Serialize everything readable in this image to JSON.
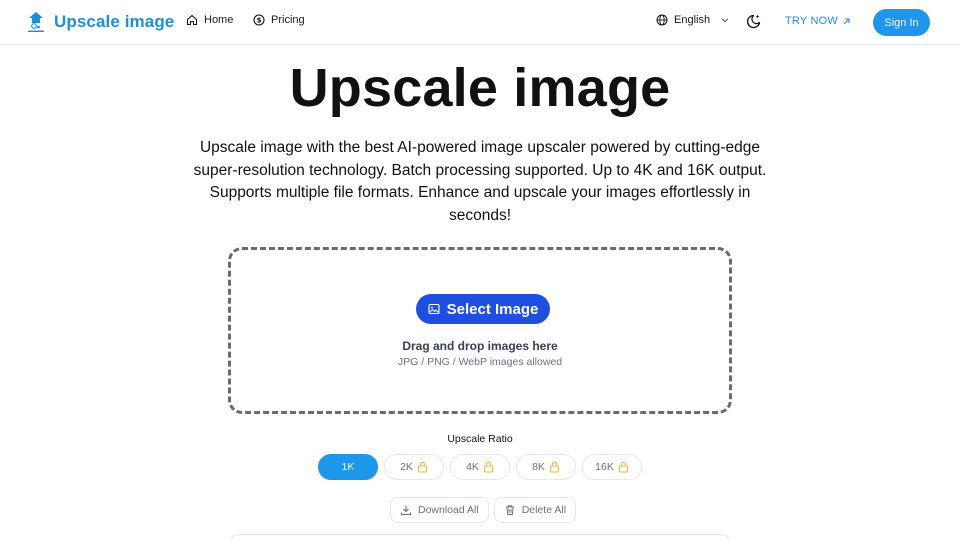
{
  "header": {
    "logo_text": "Upscale image",
    "logo_icon": "upscale-logo-icon",
    "nav": [
      {
        "label": "Home",
        "icon": "home-icon"
      },
      {
        "label": "Pricing",
        "icon": "dollar-circle-icon"
      }
    ],
    "language": "English",
    "theme_toggle_icon": "moon-sparkle-icon",
    "try_now": "TRY NOW",
    "sign_in": "Sign In"
  },
  "hero": {
    "title": "Upscale image",
    "description": "Upscale image with the best AI-powered image upscaler powered by cutting-edge super-resolution technology. Batch processing supported. Up to 4K and 16K output. Supports multiple file formats. Enhance and upscale your images effortlessly in seconds!"
  },
  "dropzone": {
    "select_label": "Select Image",
    "drag_text": "Drag and drop images here",
    "formats_text": "JPG / PNG / WebP images allowed"
  },
  "ratio": {
    "label": "Upscale Ratio",
    "options": [
      {
        "label": "1K",
        "selected": true,
        "locked": false
      },
      {
        "label": "2K",
        "selected": false,
        "locked": true
      },
      {
        "label": "4K",
        "selected": false,
        "locked": true
      },
      {
        "label": "8K",
        "selected": false,
        "locked": true
      },
      {
        "label": "16K",
        "selected": false,
        "locked": true
      }
    ]
  },
  "actions": {
    "download_all": "Download All",
    "delete_all": "Delete All"
  },
  "colors": {
    "brand": "#1e8fe0",
    "primary_button": "#1f4fe0",
    "lock": "#f2b634"
  }
}
